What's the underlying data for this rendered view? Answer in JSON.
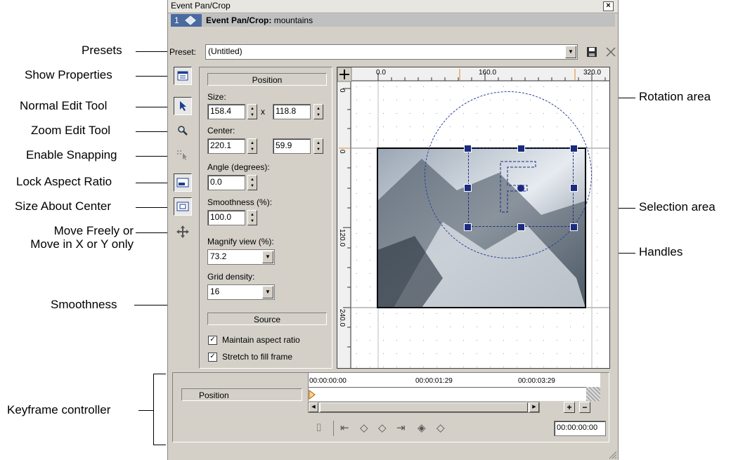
{
  "window": {
    "title": "Event Pan/Crop",
    "close": "×",
    "event_number": "1",
    "event_label": "Event Pan/Crop:",
    "event_name": "mountains"
  },
  "preset": {
    "label": "Preset:",
    "value": "(Untitled)"
  },
  "panel": {
    "position_header": "Position",
    "size_label": "Size:",
    "size_w": "158.4",
    "size_x": "x",
    "size_h": "118.8",
    "center_label": "Center:",
    "center_x": "220.1",
    "center_y": "59.9",
    "angle_label": "Angle (degrees):",
    "angle": "0.0",
    "smoothness_label": "Smoothness (%):",
    "smoothness": "100.0",
    "magnify_label": "Magnify view (%):",
    "magnify": "73.2",
    "grid_label": "Grid density:",
    "grid": "16",
    "source_header": "Source",
    "maintain_aspect": "Maintain aspect ratio",
    "stretch_fill": "Stretch to fill frame"
  },
  "ruler": {
    "h_ticks": [
      "0.0",
      "160.0",
      "320.0"
    ],
    "v_ticks": [
      "0",
      "0",
      "120.0",
      "240.0"
    ]
  },
  "keyframe": {
    "track_label": "Position",
    "times": [
      "00:00:00:00",
      "00:00:01:29",
      "00:00:03:29"
    ],
    "timecode": "00:00:00:00",
    "plus": "+",
    "minus": "−"
  },
  "callouts": {
    "presets": "Presets",
    "show_properties": "Show Properties",
    "normal_edit": "Normal Edit Tool",
    "zoom_edit": "Zoom Edit Tool",
    "enable_snapping": "Enable Snapping",
    "lock_aspect": "Lock Aspect Ratio",
    "size_about_center": "Size About Center",
    "move_freely_1": "Move Freely or",
    "move_freely_2": "Move in X or Y only",
    "smoothness": "Smoothness",
    "keyframe_controller": "Keyframe controller",
    "rotation_area": "Rotation area",
    "selection_area": "Selection area",
    "handles": "Handles"
  }
}
